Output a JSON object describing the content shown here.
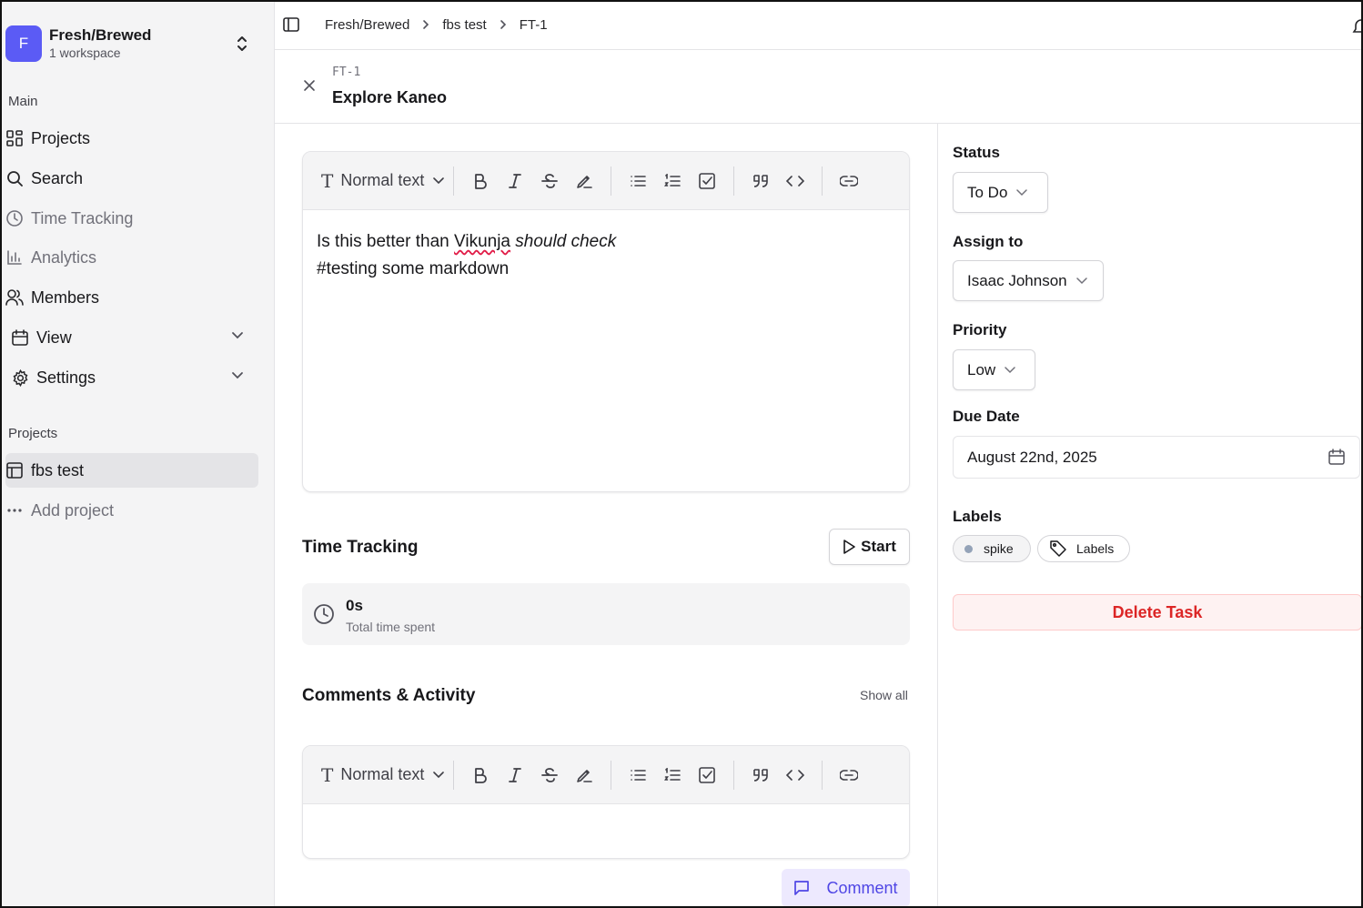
{
  "workspace": {
    "initial": "F",
    "name": "Fresh/Brewed",
    "subtitle": "1 workspace"
  },
  "sidebar": {
    "main_label": "Main",
    "items": [
      {
        "label": "Projects",
        "icon": "grid-icon"
      },
      {
        "label": "Search",
        "icon": "search-icon"
      },
      {
        "label": "Time Tracking",
        "icon": "clock-icon"
      },
      {
        "label": "Analytics",
        "icon": "bar-chart-icon"
      },
      {
        "label": "Members",
        "icon": "users-icon"
      },
      {
        "label": "View",
        "icon": "calendar-icon"
      },
      {
        "label": "Settings",
        "icon": "gear-icon"
      }
    ],
    "projects_label": "Projects",
    "projects": [
      {
        "label": "fbs test",
        "icon": "layout-icon"
      }
    ],
    "add_project": "Add project"
  },
  "breadcrumb": [
    "Fresh/Brewed",
    "fbs test",
    "FT-1"
  ],
  "task": {
    "id": "FT-1",
    "title": "Explore Kaneo"
  },
  "editor": {
    "format": "Normal text",
    "line1_plain": "Is this better than ",
    "line1_misspelled": "Vikunja",
    "line1_italic": "should check",
    "line2": "#testing some markdown"
  },
  "time_tracking": {
    "title": "Time Tracking",
    "start_label": "Start",
    "value": "0s",
    "caption": "Total time spent"
  },
  "comments": {
    "title": "Comments & Activity",
    "show_all": "Show all",
    "format": "Normal text",
    "submit_label": "Comment"
  },
  "details": {
    "status_label": "Status",
    "status_value": "To Do",
    "assign_label": "Assign to",
    "assign_value": "Isaac Johnson",
    "priority_label": "Priority",
    "priority_value": "Low",
    "due_label": "Due Date",
    "due_value": "August 22nd, 2025",
    "labels_label": "Labels",
    "label_chip": "spike",
    "labels_button": "Labels",
    "delete_label": "Delete Task"
  },
  "colors": {
    "accent": "#5b5bf5",
    "danger": "#dc2626",
    "comment": "#4f46e5"
  }
}
